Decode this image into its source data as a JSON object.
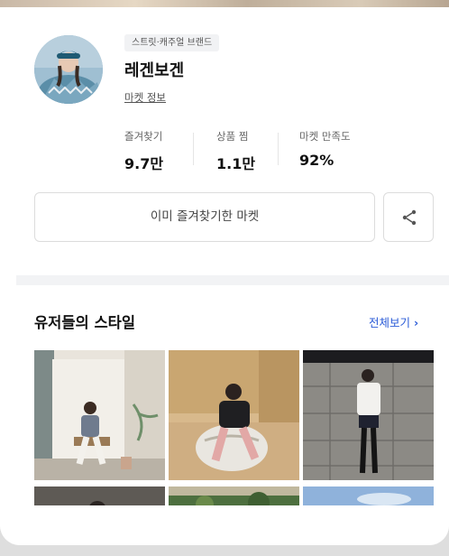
{
  "shop": {
    "category_tag": "스트릿·캐주얼 브랜드",
    "name": "레겐보겐",
    "market_info_link": "마켓 정보"
  },
  "stats": [
    {
      "label": "즐겨찾기",
      "value": "9.7만"
    },
    {
      "label": "상품 찜",
      "value": "1.1만"
    },
    {
      "label": "마켓 만족도",
      "value": "92%"
    }
  ],
  "actions": {
    "favorite_label": "이미 즐겨찾기한 마켓",
    "share_icon": "share-icon"
  },
  "user_styles": {
    "title": "유저들의 스타일",
    "see_all_label": "전체보기",
    "see_all_chevron": "›",
    "photos": [
      {
        "icon": "photo-icon"
      },
      {
        "icon": "photo-icon"
      },
      {
        "icon": "photo-icon"
      },
      {
        "icon": "photo-icon"
      },
      {
        "icon": "photo-icon"
      },
      {
        "icon": "photo-icon"
      }
    ]
  },
  "colors": {
    "link_blue": "#2a5bd7",
    "section_gap": "#f2f3f5",
    "border": "#dcdcdc"
  }
}
